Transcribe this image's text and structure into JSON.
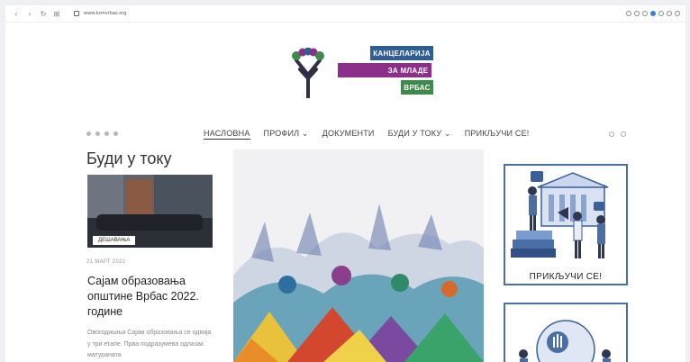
{
  "browser": {
    "url": "www.kzmvrbas.org",
    "nav_icons": [
      "back-icon",
      "forward-icon",
      "reload-icon",
      "apps-icon"
    ]
  },
  "logo": {
    "line1": "КАНЦЕЛАРИЈА",
    "line2": "ЗА МЛАДЕ",
    "line3": "ВРБАС"
  },
  "nav": {
    "items": [
      "НАСЛОВНА",
      "ПРОФИЛ ⌄",
      "ДОКУМЕНТИ",
      "БУДИ У ТОКУ ⌄",
      "ПРИКЉУЧИ СЕ!"
    ]
  },
  "feature": {
    "section_title": "Буди у току",
    "tag": "ДЕШАВАЊА",
    "date": "21 МАРТ 2022",
    "headline": "Сајам образовања општине Врбас 2022. године",
    "excerpt": "Овогодишњи Сајам образовања се одвија у три етапе. Прва подразумева одлазак матураната"
  },
  "sidebar": {
    "banner1_label": "ПРИКЉУЧИ СЕ!"
  },
  "colors": {
    "brand_blue": "#2e5e96",
    "brand_purple": "#8b2f8a",
    "brand_green": "#3d8a4a"
  }
}
